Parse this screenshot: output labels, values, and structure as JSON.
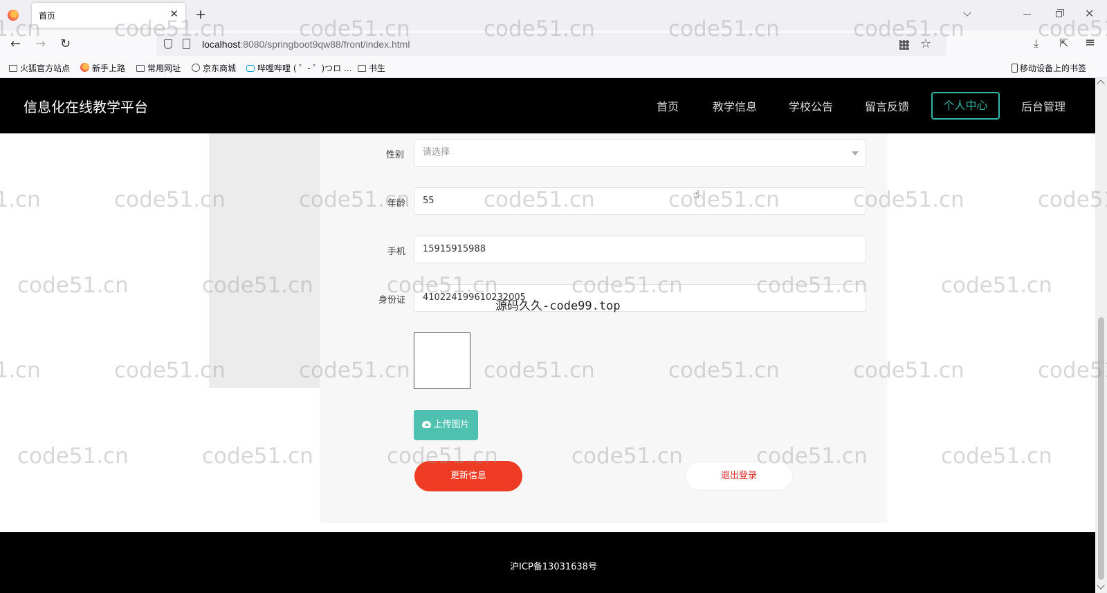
{
  "browser": {
    "tab_title": "首页",
    "tab_close": "✕",
    "new_tab": "+",
    "back": "←",
    "forward": "→",
    "reload": "↻",
    "url_host": "localhost",
    "url_rest": ":8080/springboot9qw88/front/index.html",
    "star": "☆",
    "download": "⤓",
    "extensions": "⇱",
    "menu": "≡",
    "close_window": "✕",
    "bookmarks": [
      "火狐官方站点",
      "新手上路",
      "常用网址",
      "京东商城",
      "哔哩哔哩 ( ゜- ゜)つロ ...",
      "书生"
    ],
    "mobile_bookmarks": "移动设备上的书签"
  },
  "site": {
    "title": "信息化在线教学平台",
    "nav": [
      "首页",
      "教学信息",
      "学校公告",
      "留言反馈",
      "个人中心",
      "后台管理"
    ],
    "active_nav": "个人中心",
    "accent_color": "#2fb9a6"
  },
  "form": {
    "gender_label": "性别",
    "gender_placeholder": "请选择",
    "age_label": "年龄",
    "age_value": "55",
    "phone_label": "手机",
    "phone_value": "15915915988",
    "id_label": "身份证",
    "id_value": "410224199610232005",
    "upload_label": "上传图片",
    "update_label": "更新信息",
    "logout_label": "退出登录"
  },
  "footer": {
    "icp": "沪ICP备13031638号"
  },
  "watermark": {
    "text": "code51.cn",
    "stamp": "源码久久-code99.top"
  },
  "colors": {
    "upload_button": "#4fc1b0",
    "update_button": "#ee3b23",
    "logout_text": "#d9302a"
  }
}
